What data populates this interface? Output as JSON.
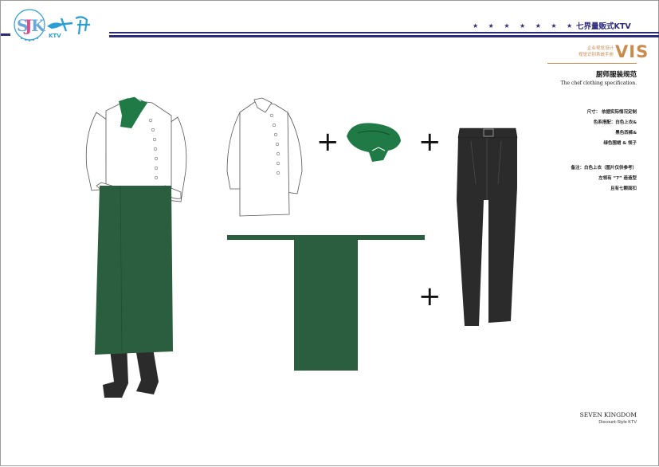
{
  "header": {
    "brand_name": "七界量贩式KTV",
    "stars": "★★★★★★★",
    "logo_text": "SJK 七界KTV",
    "brand_color": "#2c2a7a"
  },
  "vis": {
    "line1": "企业视觉设计",
    "line2": "视觉识别系统手册",
    "word": "VIS",
    "accent_color": "#c98b4e"
  },
  "page": {
    "title_cn": "厨师服装规范",
    "title_en": "The chef clothing specification."
  },
  "specs": {
    "size": "尺寸：  依据实际情况定制",
    "color1": "色系搭配：白色上衣&",
    "color2": "黑色西裤&",
    "color3": "绿色围裙 & 领子",
    "note1": "备注：白色上衣（图片仅供参考）",
    "note2": "左领有 “7” 造造型",
    "note3": "且有七颗面扣"
  },
  "footer": {
    "title": "SEVEN KINGDOM",
    "subtitle": "Discount-Style KTV"
  },
  "illustration": {
    "plus_sign": "+",
    "colors": {
      "apron": "#2a5e3f",
      "collar": "#1f7a45",
      "trousers": "#2c2a2a",
      "jacket": "#ffffff"
    }
  }
}
